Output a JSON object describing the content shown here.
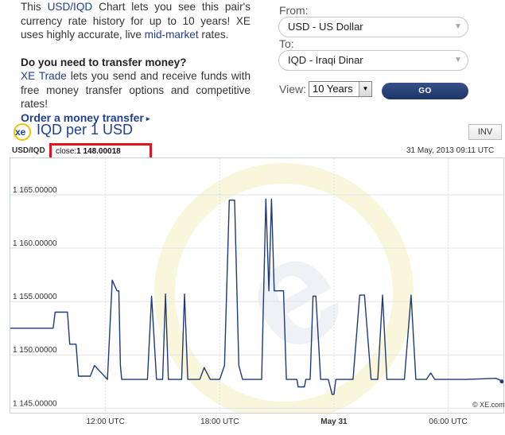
{
  "intro": {
    "text_1": "This ",
    "pair_link": "USD/IQD",
    "text_2": " Chart lets you see this pair's currency rate history for up to 10 years! XE uses highly accurate, live ",
    "midmarket_link": "mid-market",
    "text_3": " rates.",
    "transfer_heading": "Do you need to transfer money?",
    "xe_trade_link": "XE Trade",
    "transfer_text": " lets you send and receive funds with free money transfer options and competitive rates!",
    "order_link": "Order a money transfer",
    "order_arrow": "▸"
  },
  "converter": {
    "from_label": "From:",
    "from_value": "USD - US Dollar",
    "to_label": "To:",
    "to_value": "IQD - Iraqi Dinar",
    "view_label": "View:",
    "view_value": "10 Years",
    "go_label": "GO",
    "chevron": "▼"
  },
  "chart_header": {
    "logo_text": "xe",
    "title": "IQD per 1 USD",
    "inv_label": "INV",
    "pair": "USD/IQD",
    "close_label": "close:",
    "close_value": "1 148.00018",
    "timestamp": "31 May, 2013 09:11 UTC",
    "watermark": "© XE.com"
  },
  "colors": {
    "line": "#1f3a7a",
    "grid": "#dde3ea",
    "accent_red": "#e0141f",
    "link": "#1f3f8f"
  },
  "chart_data": {
    "type": "line",
    "title": "IQD per 1 USD",
    "ylabel": "",
    "xlabel": "",
    "ylim": [
      1144.5,
      1168.5
    ],
    "y_ticks": [
      "1 165.00000",
      "1 160.00000",
      "1 155.00000",
      "1 150.00000",
      "1 145.00000"
    ],
    "y_tick_values": [
      1165,
      1160,
      1155,
      1150,
      1145
    ],
    "x_ticks": [
      {
        "label": "12:00 UTC",
        "t": 5.0,
        "bold": false
      },
      {
        "label": "18:00 UTC",
        "t": 11.0,
        "bold": false
      },
      {
        "label": "May 31",
        "t": 17.0,
        "bold": true
      },
      {
        "label": "06:00 UTC",
        "t": 23.0,
        "bold": false
      }
    ],
    "x_unit": "hours since 07:00 UTC, 30 May",
    "grid": true,
    "series": [
      {
        "values": [
          [
            0.0,
            1152.5
          ],
          [
            2.25,
            1152.5
          ],
          [
            2.35,
            1154.0
          ],
          [
            3.0,
            1154.0
          ],
          [
            3.12,
            1151.0
          ],
          [
            3.45,
            1151.0
          ],
          [
            3.58,
            1148.0
          ],
          [
            4.2,
            1148.0
          ],
          [
            4.42,
            1149.0
          ],
          [
            5.1,
            1147.7
          ],
          [
            5.35,
            1157.0
          ],
          [
            5.6,
            1156.0
          ],
          [
            5.7,
            1156.0
          ],
          [
            5.78,
            1149.0
          ],
          [
            5.85,
            1147.7
          ],
          [
            7.2,
            1147.7
          ],
          [
            7.42,
            1155.5
          ],
          [
            7.68,
            1147.7
          ],
          [
            8.0,
            1147.7
          ],
          [
            8.15,
            1155.7
          ],
          [
            8.3,
            1147.7
          ],
          [
            9.0,
            1147.7
          ],
          [
            9.15,
            1155.7
          ],
          [
            9.32,
            1147.7
          ],
          [
            9.95,
            1147.7
          ],
          [
            10.18,
            1148.8
          ],
          [
            10.5,
            1147.7
          ],
          [
            11.0,
            1147.7
          ],
          [
            11.25,
            1149.0
          ],
          [
            11.5,
            1164.5
          ],
          [
            11.78,
            1164.5
          ],
          [
            12.0,
            1149.0
          ],
          [
            12.2,
            1147.7
          ],
          [
            13.2,
            1147.7
          ],
          [
            13.42,
            1164.6
          ],
          [
            13.58,
            1156.0
          ],
          [
            13.72,
            1164.6
          ],
          [
            13.86,
            1156.0
          ],
          [
            14.35,
            1156.0
          ],
          [
            14.5,
            1147.7
          ],
          [
            15.05,
            1147.7
          ],
          [
            15.12,
            1147.0
          ],
          [
            15.2,
            1147.0
          ],
          [
            15.45,
            1147.0
          ],
          [
            15.52,
            1147.7
          ],
          [
            15.75,
            1147.7
          ],
          [
            15.9,
            1155.5
          ],
          [
            16.05,
            1155.5
          ],
          [
            16.3,
            1147.7
          ],
          [
            16.7,
            1147.7
          ],
          [
            16.9,
            1146.3
          ],
          [
            17.0,
            1146.3
          ],
          [
            17.1,
            1147.7
          ],
          [
            18.0,
            1147.7
          ],
          [
            18.35,
            1155.6
          ],
          [
            18.6,
            1155.6
          ],
          [
            18.95,
            1147.7
          ],
          [
            19.3,
            1147.7
          ],
          [
            19.55,
            1155.6
          ],
          [
            19.78,
            1147.7
          ],
          [
            20.7,
            1147.7
          ],
          [
            21.05,
            1155.6
          ],
          [
            21.3,
            1147.7
          ],
          [
            21.85,
            1147.7
          ],
          [
            22.08,
            1148.3
          ],
          [
            22.3,
            1147.7
          ],
          [
            24.0,
            1147.7
          ],
          [
            25.5,
            1147.8
          ],
          [
            25.9,
            1147.5
          ]
        ]
      }
    ]
  }
}
